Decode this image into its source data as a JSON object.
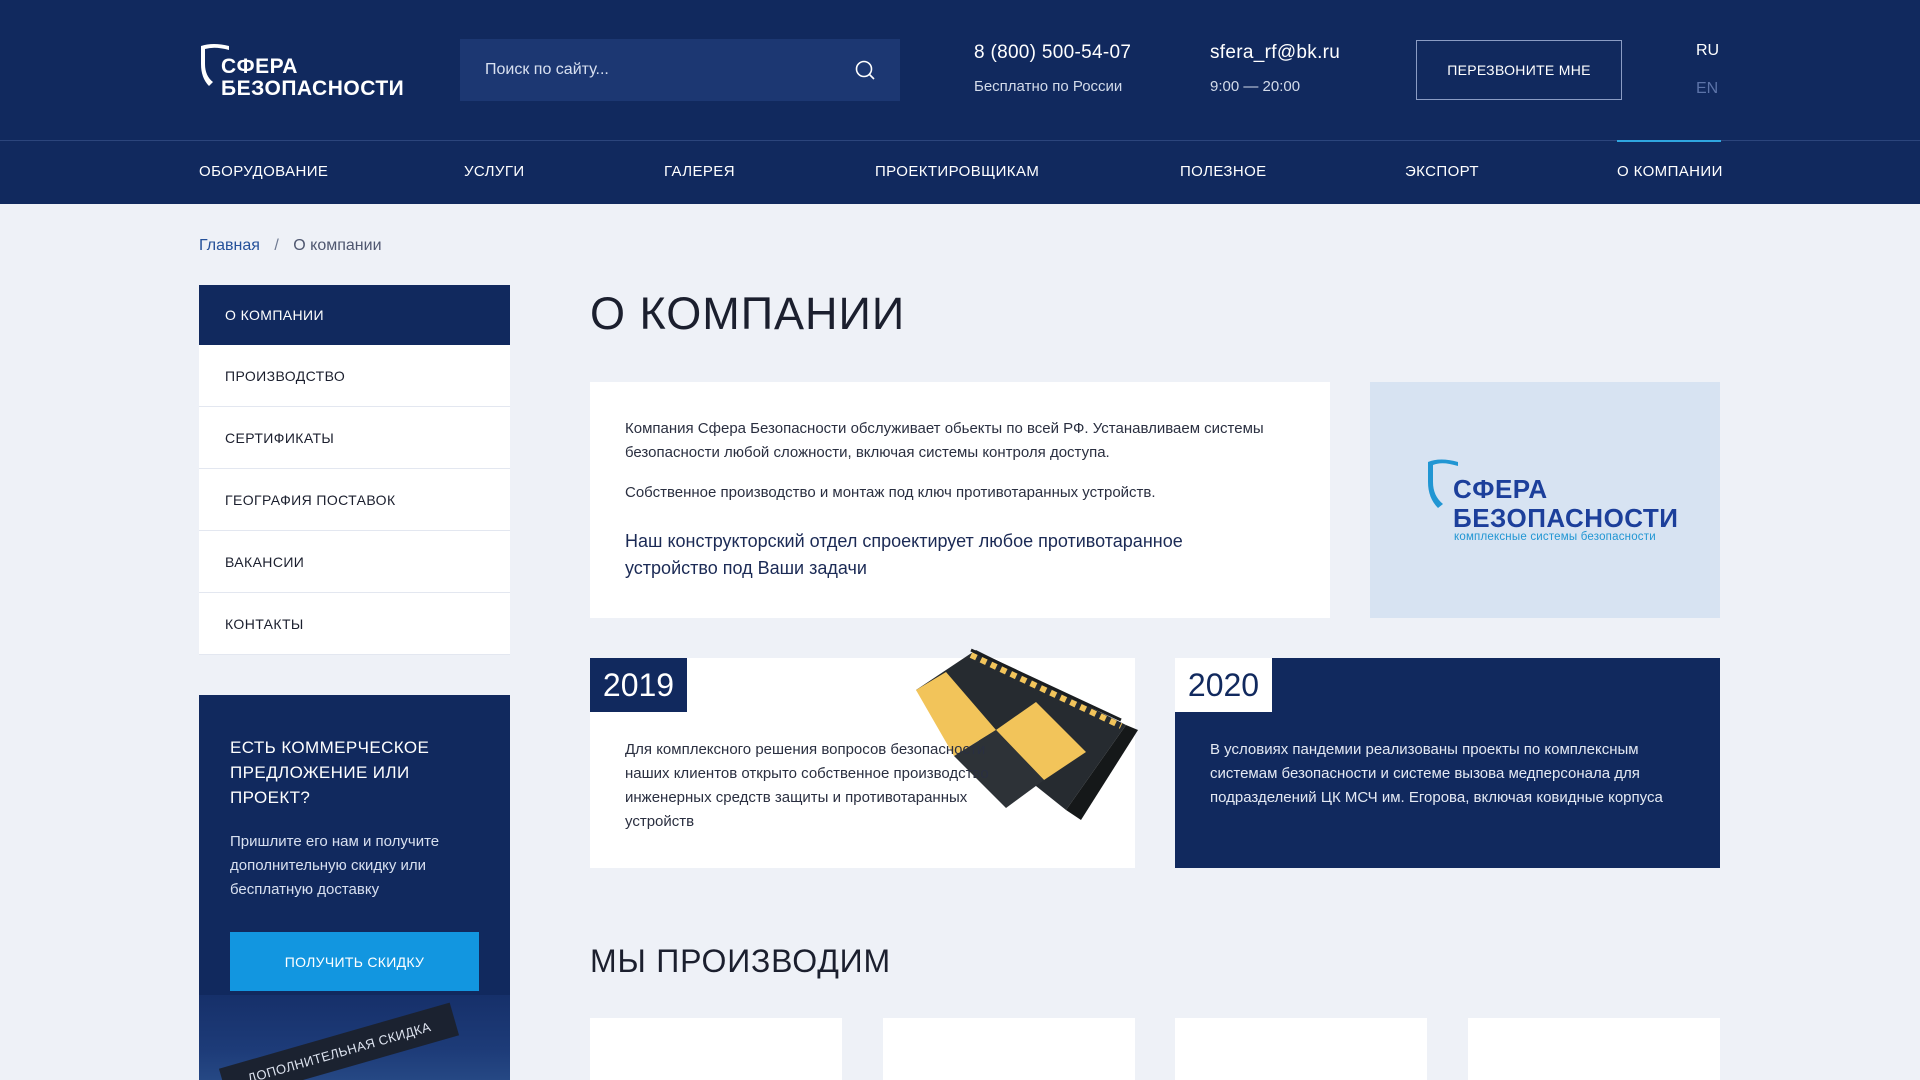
{
  "header": {
    "logo_line1": "СФЕРА",
    "logo_line2": "БЕЗОПАСНОСТИ",
    "search_placeholder": "Поиск по сайту...",
    "phone": "8 (800) 500-54-07",
    "phone_note": "Бесплатно по России",
    "email": "sfera_rf@bk.ru",
    "hours": "9:00 — 20:00",
    "callback_label": "ПЕРЕЗВОНИТЕ МНЕ",
    "lang_ru": "RU",
    "lang_en": "EN"
  },
  "nav": {
    "items": [
      {
        "label": "ОБОРУДОВАНИЕ"
      },
      {
        "label": "УСЛУГИ"
      },
      {
        "label": "ГАЛЕРЕЯ"
      },
      {
        "label": "ПРОЕКТИРОВЩИКАМ"
      },
      {
        "label": "ПОЛЕЗНОЕ"
      },
      {
        "label": "ЭКСПОРТ"
      },
      {
        "label": "О КОМПАНИИ"
      }
    ],
    "active": "О КОМПАНИИ"
  },
  "breadcrumb": {
    "home": "Главная",
    "separator": "/",
    "current": "О компании"
  },
  "sidebar": {
    "items": [
      {
        "label": "О КОМПАНИИ"
      },
      {
        "label": "ПРОИЗВОДСТВО"
      },
      {
        "label": "СЕРТИФИКАТЫ"
      },
      {
        "label": "ГЕОГРАФИЯ ПОСТАВОК"
      },
      {
        "label": "ВАКАНСИИ"
      },
      {
        "label": "КОНТАКТЫ"
      }
    ]
  },
  "promo": {
    "heading": "ЕСТЬ КОММЕРЧЕСКОЕ ПРЕДЛОЖЕНИЕ ИЛИ ПРОЕКТ?",
    "text": "Пришлите его нам и получите дополнительную скидку или бесплатную доставку",
    "button_label": "ПОЛУЧИТЬ СКИДКУ",
    "ribbon": "ДОПОЛНИТЕЛЬНАЯ СКИДКА"
  },
  "main": {
    "title": "О КОМПАНИИ",
    "intro_p1": "Компания Сфера Безопасности обслуживает обьекты по всей РФ. Устанавливаем системы безопасности любой сложности, включая системы контроля доступа.",
    "intro_p2": "Собственное производство и монтаж под ключ противотаранных устройств.",
    "intro_p3": "Наш конструкторский отдел спроектирует любое противотаранное устройство под Ваши задачи",
    "logo_line1": "СФЕРА",
    "logo_line2": "БЕЗОПАСНОСТИ",
    "logo_tagline": "комплексные системы безопасности",
    "card_2019": {
      "year": "2019",
      "text": "Для комплексного решения вопросов безопасности наших клиентов открыто собственное производство инженерных средств защиты и противотаранных устройств"
    },
    "card_2020": {
      "year": "2020",
      "text": "В условиях пандемии реализованы проекты по комплексным системам безопасности и системе вызова медперсонала для подразделений ЦК МСЧ им. Егорова, включая ковидные корпуса"
    },
    "section_title": "МЫ ПРОИЗВОДИМ"
  },
  "colors": {
    "navy": "#11295e",
    "accent_blue": "#1296e0",
    "page_bg": "#eef1f7"
  }
}
